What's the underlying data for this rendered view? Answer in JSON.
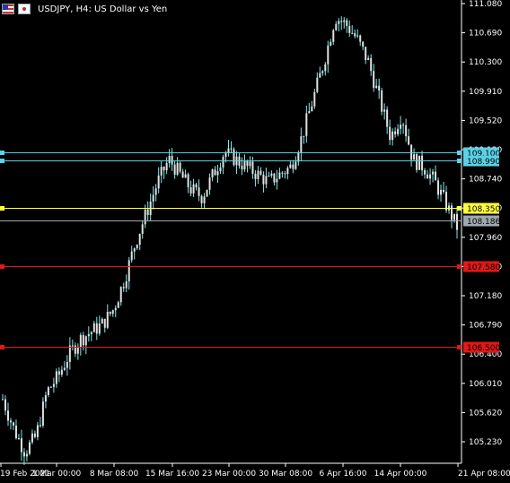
{
  "header": {
    "symbol_title": "USDJPY, H4:  US Dollar vs Yen",
    "flag_icons": [
      "us-flag-icon",
      "japan-flag-icon"
    ]
  },
  "colors": {
    "background": "#000000",
    "candle": "#e0e0e0",
    "wick": "#7fe9e9",
    "cyan_level": "#5ad2e6",
    "yellow_level": "#ffff3c",
    "gray_level": "#a0a8b0",
    "red_level": "#e11818",
    "axis": "#ffffff"
  },
  "chart_data": {
    "type": "candlestick",
    "title": "USDJPY, H4:  US Dollar vs Yen",
    "price_ticks": [
      "111.080",
      "110.690",
      "110.300",
      "109.910",
      "109.520",
      "109.130",
      "108.740",
      "108.350",
      "107.960",
      "107.570",
      "107.180",
      "106.790",
      "106.400",
      "106.010",
      "105.620",
      "105.230"
    ],
    "time_ticks": [
      "19 Feb 2021",
      "1 Mar 00:00",
      "8 Mar 08:00",
      "15 Mar 16:00",
      "23 Mar 00:00",
      "30 Mar 08:00",
      "6 Apr 16:00",
      "14 Apr 00:00",
      "21 Apr 08:00"
    ],
    "ylim": [
      105.0,
      111.2
    ],
    "horizontal_levels": [
      {
        "label": "109.100",
        "value": 109.1,
        "color": "cyan"
      },
      {
        "label": "108.990",
        "value": 108.99,
        "color": "cyan"
      },
      {
        "label": "108.350",
        "value": 108.35,
        "color": "yellow"
      },
      {
        "label": "108.186",
        "value": 108.186,
        "color": "gray"
      },
      {
        "label": "107.580",
        "value": 107.58,
        "color": "red"
      },
      {
        "label": "106.500",
        "value": 106.5,
        "color": "red"
      }
    ],
    "close_path": [
      105.8,
      105.4,
      105.1,
      105.3,
      105.9,
      106.1,
      106.4,
      106.6,
      106.7,
      106.8,
      107.0,
      107.4,
      107.9,
      108.3,
      108.7,
      109.0,
      108.8,
      108.6,
      108.5,
      108.8,
      109.1,
      109.0,
      108.9,
      108.8,
      108.7,
      108.8,
      108.9,
      109.3,
      109.8,
      110.3,
      110.9,
      110.8,
      110.6,
      110.3,
      109.8,
      109.3,
      109.6,
      109.0,
      108.9,
      108.7,
      108.4,
      108.1
    ]
  }
}
